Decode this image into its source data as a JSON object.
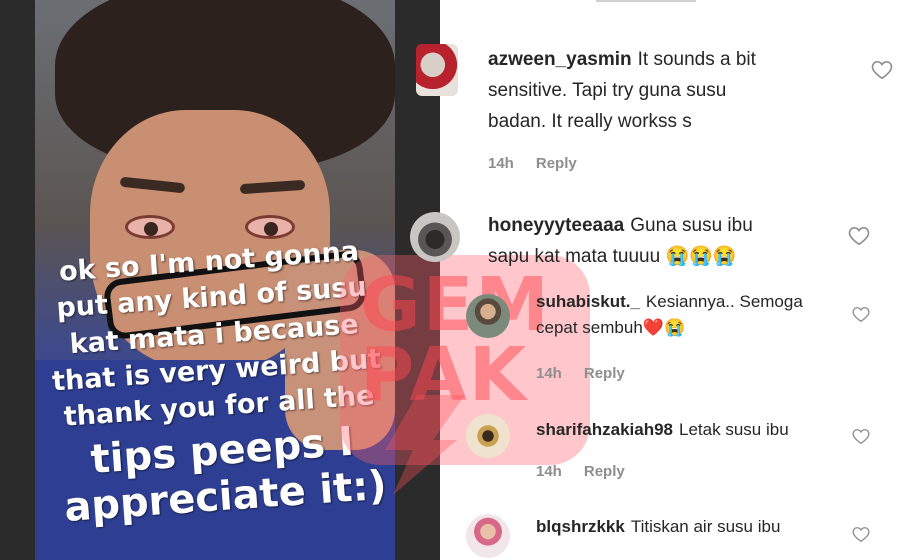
{
  "story": {
    "caption_lines": [
      "ok so I'm not gonna",
      "put any kind of susu",
      "kat mata i because",
      "that is very weird but",
      "thank you for all the",
      "tips peeps I",
      "appreciate it:)"
    ]
  },
  "watermark": {
    "text_line1": "GEM",
    "text_line2": "PAK"
  },
  "comments": [
    {
      "username": "azween_yasmin",
      "text_line1": "It sounds a bit",
      "text_line2": "sensitive. Tapi try guna susu",
      "text_line3": "badan. It really workss s",
      "time": "14h",
      "reply": "Reply",
      "avatar_icon": "avatar-photo-icon"
    },
    {
      "username": "honeyyyteeaaa",
      "text_line1": "Guna susu ibu",
      "text_line2": "sapu kat mata tuuuu 😭😭😭",
      "avatar_icon": "avatar-photo-icon"
    },
    {
      "username": "suhabiskut._",
      "text_line1": "Kesiannya.. Semoga",
      "text_line2": "cepat sembuh❤️😭",
      "time": "14h",
      "reply": "Reply",
      "avatar_icon": "avatar-photo-icon"
    },
    {
      "username": "sharifahzakiah98",
      "text_line1": "Letak susu ibu",
      "time": "14h",
      "reply": "Reply",
      "avatar_icon": "avatar-photo-icon"
    },
    {
      "username": "blqshrzkkk",
      "text_line1": "Titiskan air susu ibu",
      "avatar_icon": "avatar-photo-icon"
    }
  ],
  "colors": {
    "text": "#262626",
    "meta": "#8e8e8e",
    "watermark": "#ff4650"
  }
}
